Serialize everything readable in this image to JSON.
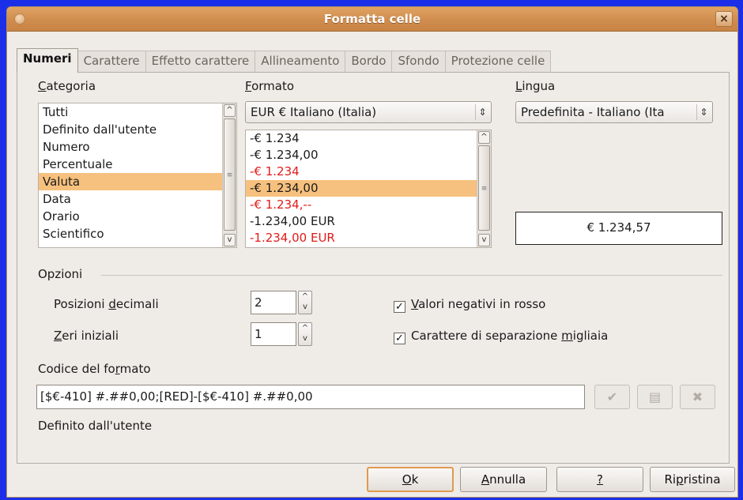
{
  "window": {
    "title": "Formatta celle",
    "close_glyph": "×"
  },
  "tabs": [
    {
      "label": "Numeri",
      "active": true
    },
    {
      "label": "Carattere"
    },
    {
      "label": "Effetto carattere"
    },
    {
      "label": "Allineamento"
    },
    {
      "label": "Bordo"
    },
    {
      "label": "Sfondo"
    },
    {
      "label": "Protezione celle"
    }
  ],
  "category": {
    "label_first": "C",
    "label_rest": "ategoria",
    "items": [
      "Tutti",
      "Definito dall'utente",
      "Numero",
      "Percentuale",
      "Valuta",
      "Data",
      "Orario",
      "Scientifico"
    ],
    "selected": "Valuta"
  },
  "format": {
    "label_first": "F",
    "label_rest": "ormato",
    "currency_combo": "EUR  €  Italiano (Italia)",
    "items": [
      {
        "text": "-€ 1.234",
        "red": false
      },
      {
        "text": "-€ 1.234,00",
        "red": false
      },
      {
        "text": "-€ 1.234",
        "red": true
      },
      {
        "text": "-€ 1.234,00",
        "red": false,
        "selected": true
      },
      {
        "text": "-€ 1.234,--",
        "red": true
      },
      {
        "text": "-1.234,00 EUR",
        "red": false
      },
      {
        "text": "-1.234,00 EUR",
        "red": true
      }
    ]
  },
  "language": {
    "label_first": "L",
    "label_rest": "ingua",
    "value": "Predefinita - Italiano (Ita"
  },
  "preview": "€ 1.234,57",
  "options": {
    "section": "Opzioni",
    "decimals_pre": "Posizioni ",
    "decimals_u": "d",
    "decimals_post": "ecimali",
    "decimals_value": "2",
    "zeros_u": "Z",
    "zeros_post": "eri iniziali",
    "zeros_value": "1",
    "negative_red_u": "V",
    "negative_red_post": "alori negativi in rosso",
    "negative_red_checked": true,
    "thousands_pre": "Carattere di separazione ",
    "thousands_u": "m",
    "thousands_post": "igliaia",
    "thousands_checked": true
  },
  "format_code": {
    "label_pre": "Codice del fo",
    "label_u": "r",
    "label_post": "mato",
    "value": "[$€-410] #.##0,00;[RED]-[$€-410] #.##0,00",
    "description": "Definito dall'utente"
  },
  "icons": {
    "accept": "check-icon",
    "comment": "comment-icon",
    "delete": "delete-icon"
  },
  "buttons": {
    "ok_u": "O",
    "ok_post": "k",
    "cancel_u": "A",
    "cancel_post": "nnulla",
    "help_u": "?",
    "reset_pre": "Ri",
    "reset_u": "p",
    "reset_post": "ristina"
  },
  "colors": {
    "accent": "#f6c17e",
    "title_bar": "#cf8c4e",
    "negative": "#e11a1a",
    "frame": "#1c2fe8"
  }
}
